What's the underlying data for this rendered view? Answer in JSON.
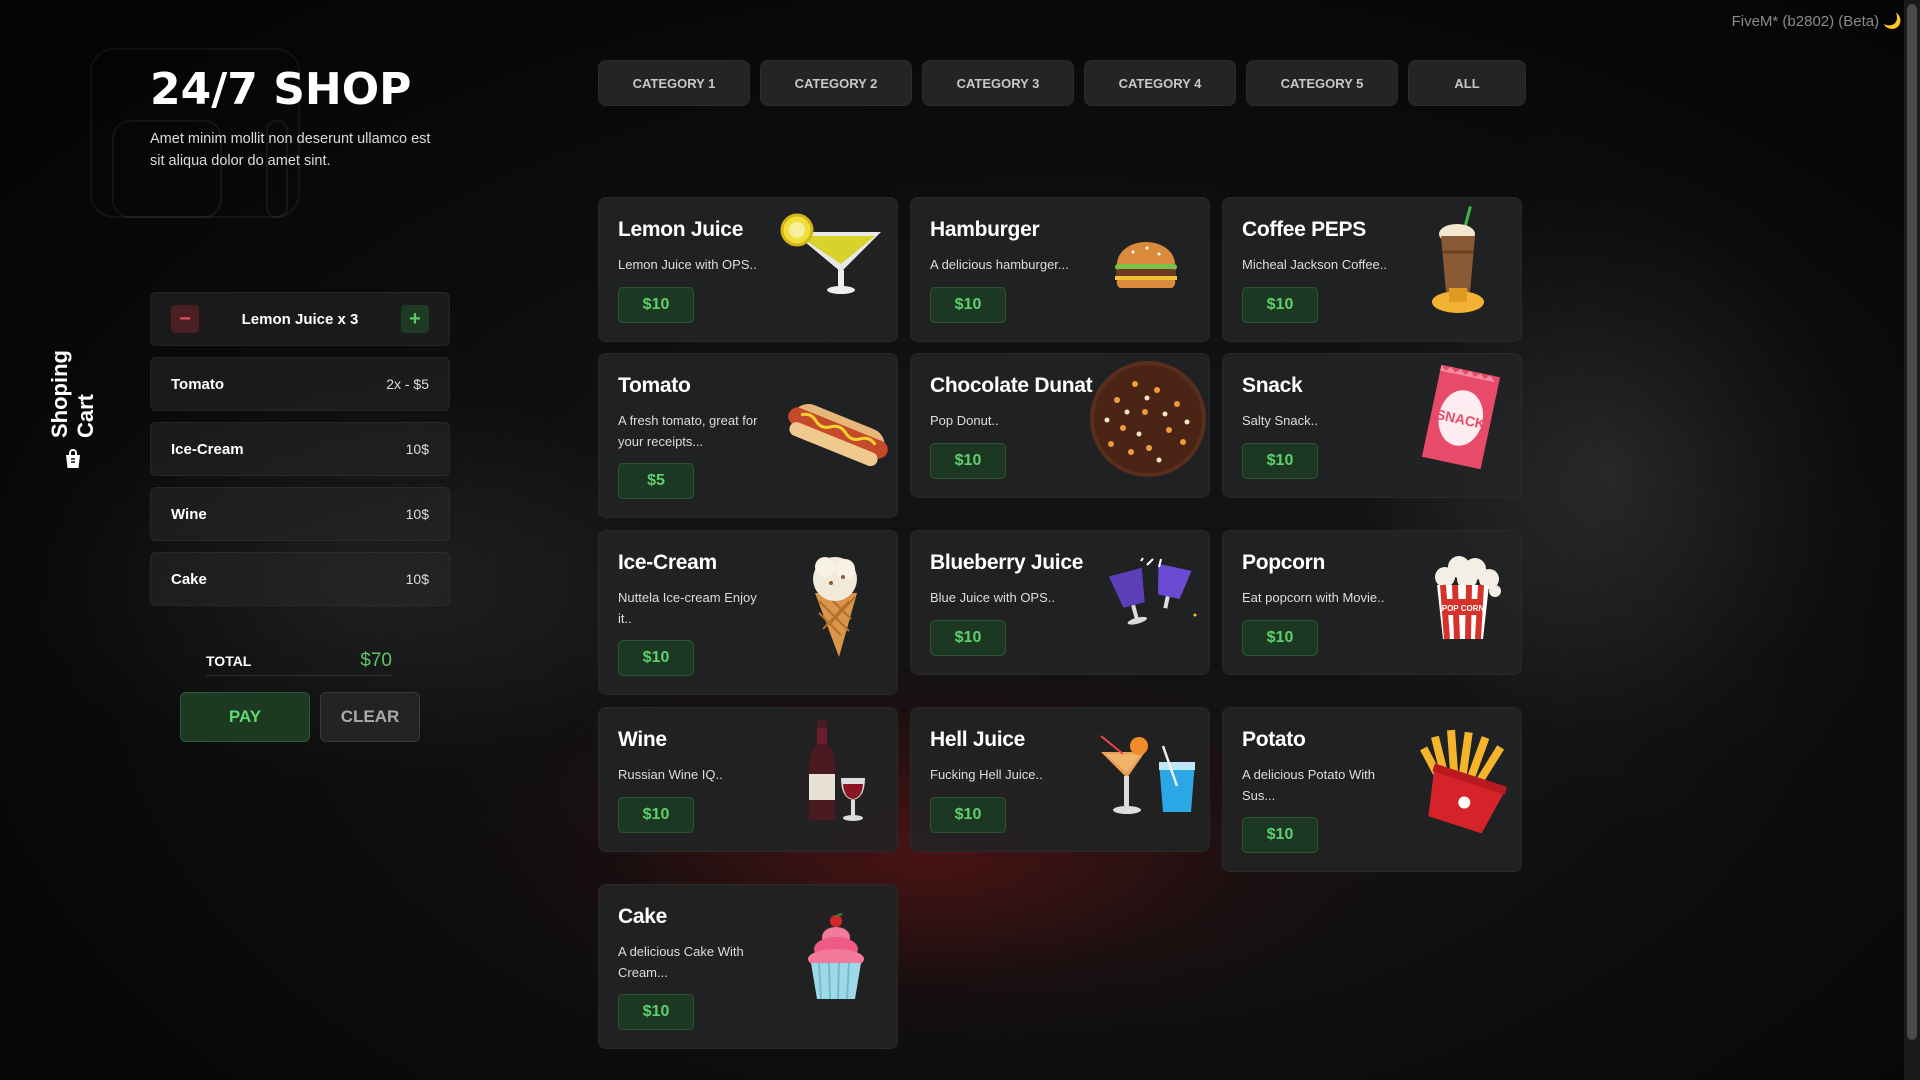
{
  "window": {
    "fivem_label": "FiveM* (b2802) (Beta) 🌙"
  },
  "header": {
    "title": "24/7 SHOP",
    "subtitle": "Amet minim mollit non deserunt ullamco est sit aliqua dolor do amet sint."
  },
  "sidebar": {
    "label": "Shoping Cart",
    "icon": "shopping-bag-icon"
  },
  "cart": {
    "active_item": {
      "label": "Lemon Juice x 3",
      "minus": "−",
      "plus": "+"
    },
    "items": [
      {
        "name": "Tomato",
        "price": "2x - $5"
      },
      {
        "name": "Ice-Cream",
        "price": "10$"
      },
      {
        "name": "Wine",
        "price": "10$"
      },
      {
        "name": "Cake",
        "price": "10$"
      }
    ],
    "total_label": "TOTAL",
    "total_value": "$70",
    "pay_label": "PAY",
    "clear_label": "CLEAR"
  },
  "tabs": [
    "CATEGORY 1",
    "CATEGORY 2",
    "CATEGORY 3",
    "CATEGORY 4",
    "CATEGORY 5",
    "ALL"
  ],
  "products": [
    {
      "name": "Lemon Juice",
      "desc": "Lemon Juice with OPS..",
      "price": "$10",
      "icon": "cocktail-icon"
    },
    {
      "name": "Hamburger",
      "desc": "A delicious hamburger...",
      "price": "$10",
      "icon": "burger-icon"
    },
    {
      "name": "Coffee PEPS",
      "desc": "Micheal Jackson Coffee..",
      "price": "$10",
      "icon": "iced-coffee-icon"
    },
    {
      "name": "Tomato",
      "desc": "A fresh tomato, great for your receipts...",
      "price": "$5",
      "icon": "hotdog-icon"
    },
    {
      "name": "Chocolate Dunat",
      "desc": "Pop Donut..",
      "price": "$10",
      "icon": "donut-icon"
    },
    {
      "name": "Snack",
      "desc": "Salty Snack..",
      "price": "$10",
      "icon": "snack-bag-icon"
    },
    {
      "name": "Ice-Cream",
      "desc": "Nuttela Ice-cream Enjoy it..",
      "price": "$10",
      "icon": "ice-cream-icon"
    },
    {
      "name": "Blueberry Juice",
      "desc": "Blue Juice with OPS..",
      "price": "$10",
      "icon": "juice-glasses-icon"
    },
    {
      "name": "Popcorn",
      "desc": "Eat popcorn with Movie..",
      "price": "$10",
      "icon": "popcorn-icon",
      "img_text": "POP CORN"
    },
    {
      "name": "Wine",
      "desc": "Russian Wine IQ..",
      "price": "$10",
      "icon": "wine-icon"
    },
    {
      "name": "Hell Juice",
      "desc": "Fucking Hell Juice..",
      "price": "$10",
      "icon": "drinks-icon"
    },
    {
      "name": "Potato",
      "desc": "A delicious Potato With Sus...",
      "price": "$10",
      "icon": "fries-icon"
    },
    {
      "name": "Cake",
      "desc": "A delicious Cake With Cream...",
      "price": "$10",
      "icon": "cupcake-icon"
    }
  ],
  "colors": {
    "accent_green": "#5fce6f",
    "minus_red": "#e05060",
    "card_bg": "#222325"
  }
}
